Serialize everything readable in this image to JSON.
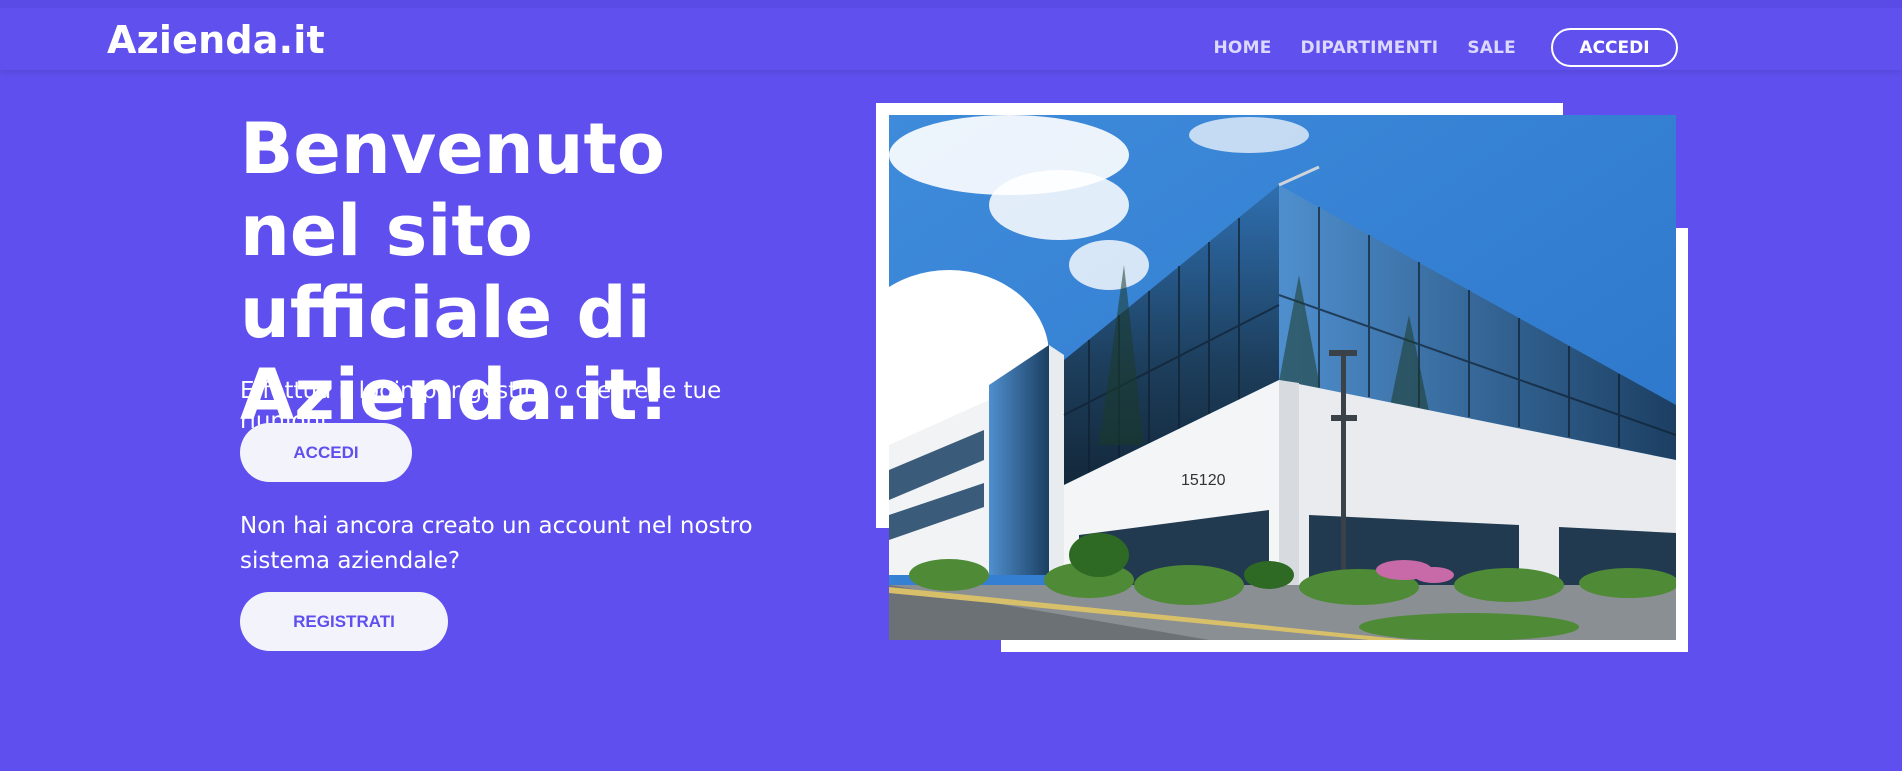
{
  "navbar": {
    "brand": "Azienda.it",
    "links": [
      "HOME",
      "DIPARTIMENTI",
      "SALE"
    ],
    "cta_label": "ACCEDI"
  },
  "hero": {
    "title": "Benvenuto nel sito ufficiale di Azienda.it!",
    "subtitle": "Effettua il login per gestire o creare le tue riunioni.",
    "login_button": "ACCEDI",
    "register_note": "Non hai ancora creato un account nel nostro sistema aziendale?",
    "register_button": "REGISTRATI"
  },
  "image": {
    "building_number": "15120"
  },
  "colors": {
    "background": "#5f4fee",
    "button_bg": "#f3f4fb",
    "button_text": "#5f4fee"
  }
}
